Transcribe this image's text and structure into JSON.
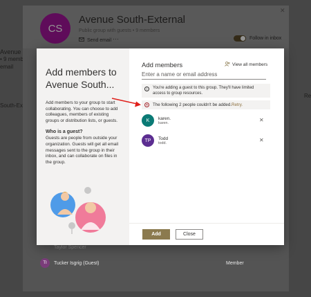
{
  "background": {
    "left_title": "Avenue South-External",
    "left_sub": "• 9 members",
    "left_email": "email",
    "left_title_2": "South-External",
    "right_col": "Re",
    "members": [
      {
        "initials": "",
        "name": "Taylor Spencer",
        "role": ""
      },
      {
        "initials": "TI",
        "name": "Tucker Isgrig (Guest)",
        "role": "Member"
      }
    ]
  },
  "group": {
    "initials": "CS",
    "name": "Avenue South-External",
    "subtitle": "Public group with guests • 9 members",
    "send_email": "Send email",
    "more": "···",
    "follow": "Follow in inbox",
    "close": "✕",
    "avatar_color": "#a4159b"
  },
  "modal": {
    "title": "Add members to Avenue South...",
    "intro": "Add members to your group to start collaborating. You can choose to add colleagues, members of existing groups or distribution lists, or guests.",
    "guest_heading": "Who is a guest?",
    "guest_body": "Guests are people from outside your organization. Guests will get all email messages sent to the group in their inbox, and can collaborate on files in the group.",
    "add_members_title": "Add members",
    "view_all": "View all members",
    "input_placeholder": "Enter a name or email address",
    "info_text": "You're adding a guest to this group. They'll have limited access to group resources.",
    "error_text": "The following 2 people couldn't be added.",
    "retry": "Retry.",
    "people": [
      {
        "initials": "K",
        "name": "karen.",
        "email": "karen.",
        "color": "#0b7a75"
      },
      {
        "initials": "TP",
        "name": "Todd",
        "email": "todd.",
        "color": "#5c2e91"
      }
    ],
    "add_button": "Add",
    "close_button": "Close"
  }
}
